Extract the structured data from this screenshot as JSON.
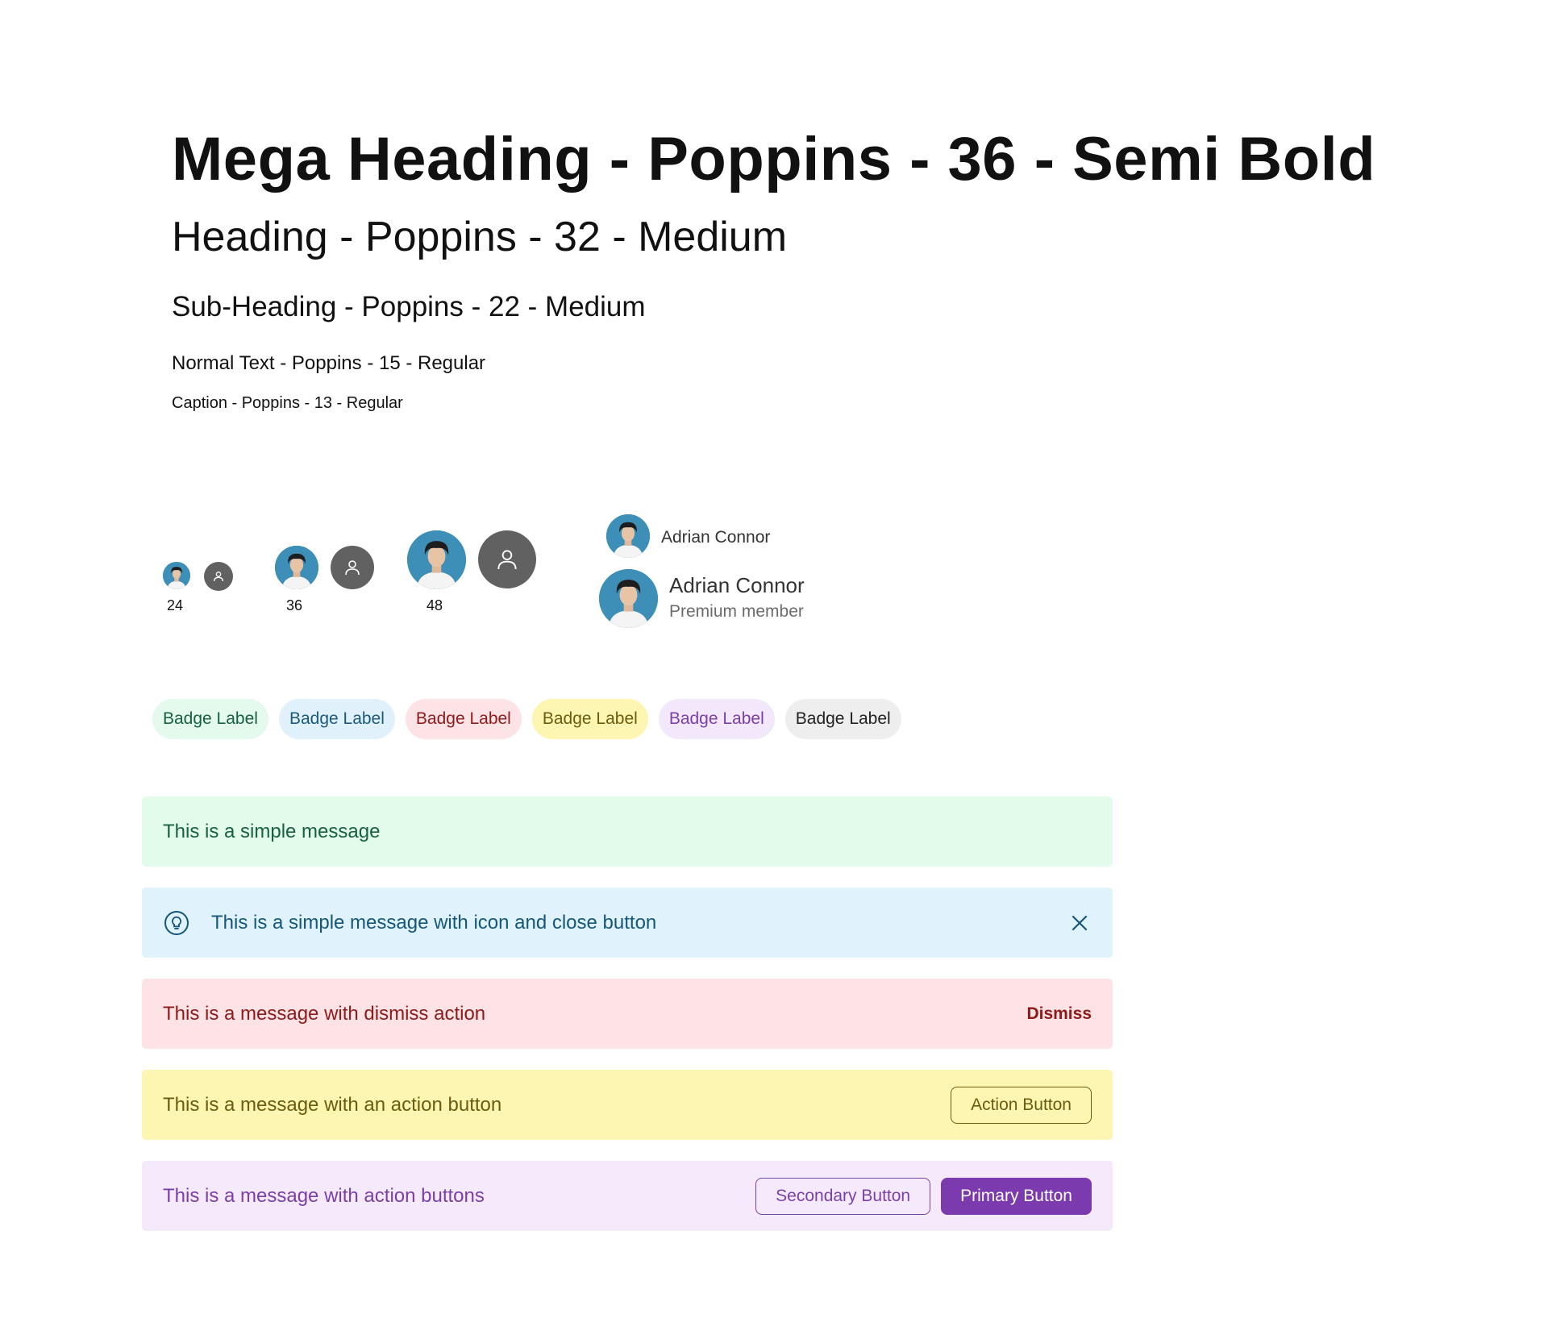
{
  "typography": {
    "mega": "Mega Heading - Poppins - 36 - Semi Bold",
    "heading": "Heading - Poppins - 32 - Medium",
    "subheading": "Sub-Heading - Poppins - 22 - Medium",
    "normal": "Normal Text - Poppins - 15 - Regular",
    "caption": "Caption - Poppins - 13 - Regular"
  },
  "avatars": {
    "sizes": [
      {
        "label": "24"
      },
      {
        "label": "36"
      },
      {
        "label": "48"
      }
    ],
    "photo_bg": "#3d8fb8",
    "placeholder_bg": "#616161",
    "user_small": {
      "name": "Adrian Connor"
    },
    "user_large": {
      "name": "Adrian Connor",
      "subtitle": "Premium member"
    }
  },
  "badges": [
    {
      "label": "Badge Label",
      "bg": "#e4faec",
      "fg": "#17623e"
    },
    {
      "label": "Badge Label",
      "bg": "#e0f1fb",
      "fg": "#1b5a7c"
    },
    {
      "label": "Badge Label",
      "bg": "#fde3e5",
      "fg": "#8e1a1a"
    },
    {
      "label": "Badge Label",
      "bg": "#fdf5b2",
      "fg": "#6b5c0f"
    },
    {
      "label": "Badge Label",
      "bg": "#f3e8fb",
      "fg": "#7a3fa8"
    },
    {
      "label": "Badge Label",
      "bg": "#eeeeee",
      "fg": "#222222"
    }
  ],
  "messages": {
    "simple": {
      "text": "This is a simple message",
      "bg": "#e2fbea",
      "fg": "#17623e"
    },
    "icon_close": {
      "text": "This is a simple message with icon and close button",
      "bg": "#e0f2fb",
      "fg": "#15577a",
      "icon": "lightbulb-icon",
      "close_icon": "close-icon"
    },
    "dismiss": {
      "text": "This is a message with dismiss action",
      "action": "Dismiss",
      "bg": "#fde3e5",
      "fg": "#8e1a1a"
    },
    "action": {
      "text": "This is a message with an action button",
      "button": "Action Button",
      "bg": "#fdf5b2",
      "fg": "#6b5c0f"
    },
    "actions": {
      "text": "This is a message with action buttons",
      "secondary": "Secondary Button",
      "primary": "Primary Button",
      "bg": "#f5eafb",
      "fg": "#7a3fa8",
      "primary_bg": "#7b3aad"
    }
  }
}
